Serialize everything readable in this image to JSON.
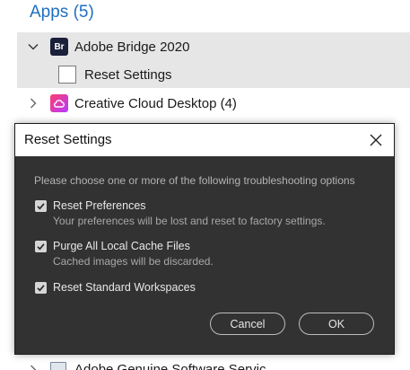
{
  "apps_header": "Apps (5)",
  "list": {
    "bridge": "Adobe Bridge 2020",
    "bridge_icon_text": "Br",
    "reset_settings": "Reset Settings",
    "creative_cloud": "Creative Cloud Desktop (4)",
    "genuine": "Adobe Genuine Software Servic"
  },
  "dialog": {
    "title": "Reset Settings",
    "instructions": "Please choose one or more of the following troubleshooting options",
    "options": [
      {
        "label": "Reset Preferences",
        "description": "Your preferences will be lost and reset to factory settings.",
        "checked": true
      },
      {
        "label": "Purge All Local Cache Files",
        "description": "Cached images will be discarded.",
        "checked": true
      },
      {
        "label": "Reset Standard Workspaces",
        "description": "",
        "checked": true
      }
    ],
    "cancel_label": "Cancel",
    "ok_label": "OK"
  },
  "colors": {
    "accent_blue": "#1f6fc1",
    "dialog_bg": "#323232",
    "selected_row_bg": "#e6e6e6"
  }
}
